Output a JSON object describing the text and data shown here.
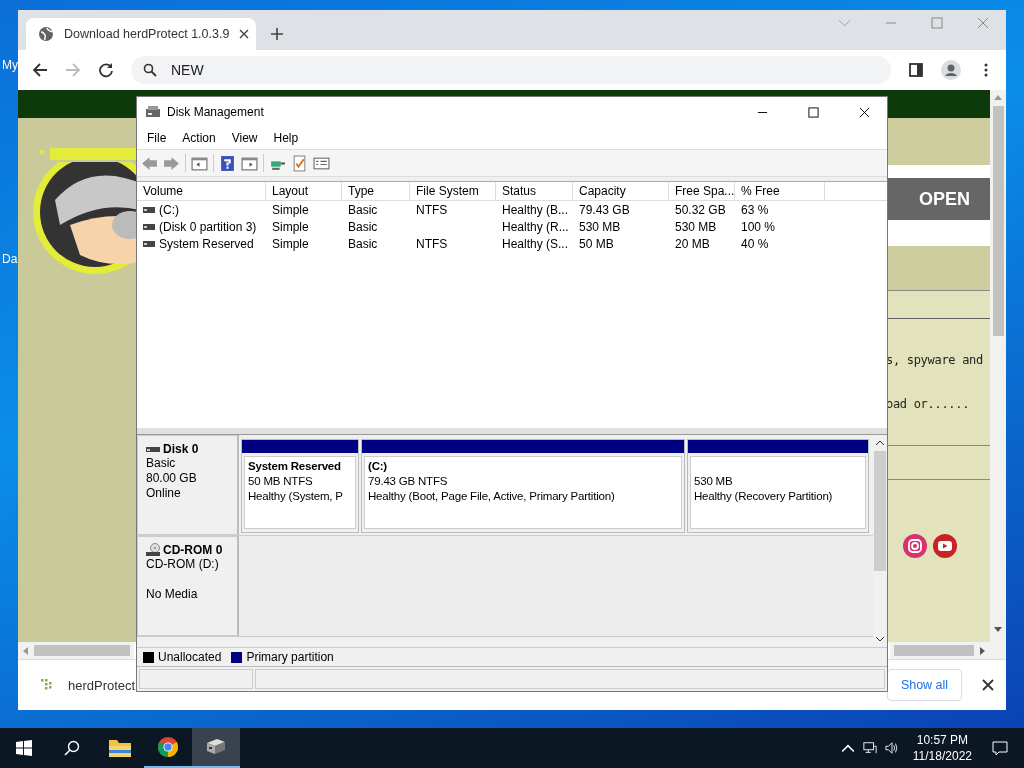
{
  "desktop": {
    "icon_labels": [
      "My",
      "Da"
    ]
  },
  "browser": {
    "tabs": [
      {
        "title": "Download herdProtect 1.0.3.9",
        "selected": true
      }
    ],
    "address": "NEW",
    "page": {
      "logo": {
        "kind": "picture"
      },
      "open_button": "OPEN",
      "text_fragments": [
        "s, spyware and",
        "oad or......"
      ]
    },
    "download_bar": {
      "file": "herdProtect",
      "show_all": "Show all"
    }
  },
  "disk_management": {
    "title": "Disk Management",
    "menu": [
      "File",
      "Action",
      "View",
      "Help"
    ],
    "columns": [
      "Volume",
      "Layout",
      "Type",
      "File System",
      "Status",
      "Capacity",
      "Free Spa...",
      "% Free"
    ],
    "rows": [
      [
        "(C:)",
        "Simple",
        "Basic",
        "NTFS",
        "Healthy (B...",
        "79.43 GB",
        "50.32 GB",
        "63 %"
      ],
      [
        "(Disk 0 partition 3)",
        "Simple",
        "Basic",
        null,
        "Healthy (R...",
        "530 MB",
        "530 MB",
        "100 %"
      ],
      [
        "System Reserved",
        "Simple",
        "Basic",
        "NTFS",
        "Healthy (S...",
        "50 MB",
        "20 MB",
        "40 %"
      ]
    ],
    "disks": [
      {
        "kind": "disk",
        "name": "Disk 0",
        "lines": [
          "Basic",
          "80.00 GB",
          "Online"
        ],
        "partitions": [
          {
            "name": "System Reserved",
            "size": "50 MB NTFS",
            "status": "Healthy (System, P"
          },
          {
            "name": "(C:)",
            "size": "79.43 GB NTFS",
            "status": "Healthy (Boot, Page File, Active, Primary Partition)"
          },
          {
            "size": "530 MB",
            "status": "Healthy (Recovery Partition)"
          }
        ]
      },
      {
        "kind": "cdrom",
        "name": "CD-ROM 0",
        "lines": [
          "CD-ROM (D:)",
          "No Media"
        ]
      }
    ],
    "legend": [
      {
        "label": "Unallocated",
        "color": "#000000"
      },
      {
        "label": "Primary partition",
        "color": "#000080"
      }
    ]
  },
  "taskbar": {
    "apps": [
      {
        "kind": "explorer",
        "running": false,
        "selected": false
      },
      {
        "kind": "chrome",
        "running": true,
        "selected": false
      },
      {
        "kind": "diskmgmt",
        "running": true,
        "selected": true
      }
    ],
    "time": "10:57 PM",
    "date": "11/18/2022"
  }
}
